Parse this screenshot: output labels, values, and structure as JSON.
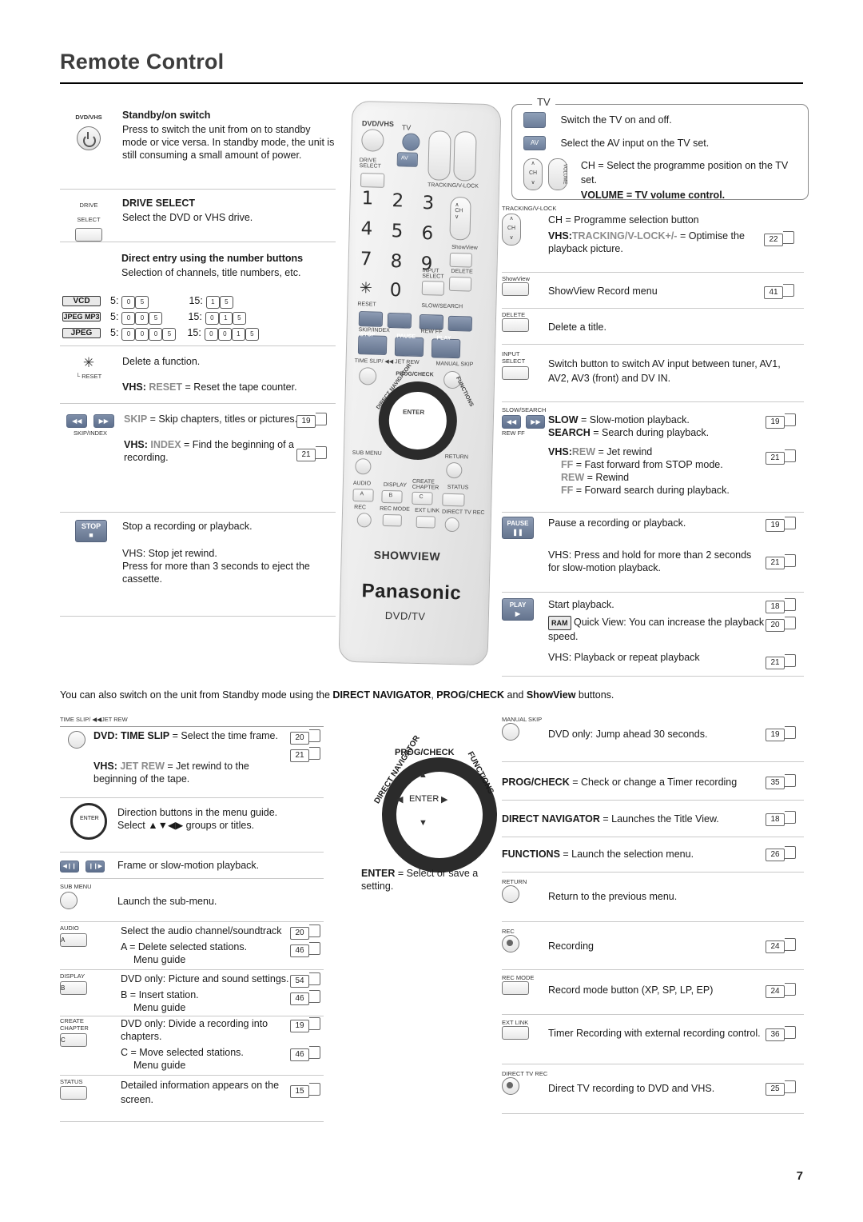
{
  "page": {
    "title": "Remote Control",
    "number": "7",
    "middle_note_parts": {
      "p1": "You can also switch on the unit from Standby mode using the ",
      "b1": "DIRECT NAVIGATOR",
      "p2": ", ",
      "b2": "PROG/CHECK",
      "p3": " and ",
      "b3": "ShowView",
      "p4": " buttons."
    }
  },
  "remote": {
    "brand": "Panasonic",
    "showview": "SHOWVIEW",
    "model": "DVD/TV",
    "dvd_vhs": "DVD/VHS",
    "tv": "TV",
    "labels": {
      "drive_select": "DRIVE\nSELECT",
      "av": "AV",
      "ch": "CH",
      "volume": "VOLUME",
      "tracking": "TRACKING/V-LOCK",
      "showview": "ShowView",
      "input_select": "INPUT\nSELECT",
      "delete": "DELETE",
      "reset": "RESET",
      "skip_index": "SKIP/INDEX",
      "slow_search": "SLOW/SEARCH",
      "rew": "REW",
      "ff": "FF",
      "stop": "STOP",
      "pause": "PAUSE",
      "play": "PLAY",
      "time_slip": "TIME SLIP/",
      "jet_rew": "JET REW",
      "manual_skip": "MANUAL SKIP",
      "direct_navigator": "DIRECT NAVIGATOR",
      "prog_check": "PROG/CHECK",
      "functions": "FUNCTIONS",
      "enter": "ENTER",
      "sub_menu": "SUB MENU",
      "return": "RETURN",
      "audio": "AUDIO",
      "display": "DISPLAY",
      "create_chapter": "CREATE\nCHAPTER",
      "status": "STATUS",
      "a": "A",
      "b": "B",
      "c": "C",
      "rec": "REC",
      "rec_mode": "REC MODE",
      "ext_link": "EXT LINK",
      "direct_tv_rec": "DIRECT TV REC"
    },
    "numbers": [
      "1",
      "2",
      "3",
      "4",
      "5",
      "6",
      "7",
      "8",
      "9",
      "0"
    ],
    "star": "✳"
  },
  "left_column": [
    {
      "id": "standby",
      "icon_label": "DVD/VHS",
      "heading": "Standby/on switch",
      "body": "Press to switch the unit from on to standby mode or vice versa. In standby mode, the unit is still consuming a small amount of power."
    },
    {
      "id": "drive-select",
      "icon_label": "DRIVE\nSELECT",
      "heading": "DRIVE SELECT",
      "body": "Select the DVD or VHS drive."
    },
    {
      "id": "number-buttons",
      "heading": "Direct entry using the number buttons",
      "body": "Selection of channels, title numbers, etc.",
      "examples": [
        {
          "tag": "VCD",
          "left_label": "5:",
          "left_digits": [
            "0",
            "5"
          ],
          "right_label": "15:",
          "right_digits": [
            "1",
            "5"
          ]
        },
        {
          "tag": "JPEG MP3",
          "left_label": "5:",
          "left_digits": [
            "0",
            "0",
            "5"
          ],
          "right_label": "15:",
          "right_digits": [
            "0",
            "1",
            "5"
          ]
        },
        {
          "tag": "JPEG",
          "left_label": "5:",
          "left_digits": [
            "0",
            "0",
            "0",
            "5"
          ],
          "right_label": "15:",
          "right_digits": [
            "0",
            "0",
            "1",
            "5"
          ]
        }
      ]
    },
    {
      "id": "delete-function",
      "icon_label": "RESET",
      "body": "Delete a function.",
      "vhs_line": {
        "prefix": "VHS:",
        "key": "RESET",
        "rest": " = Reset the tape counter."
      }
    },
    {
      "id": "skip",
      "icon_label": "SKIP/INDEX",
      "line1": {
        "key": "SKIP",
        "rest": " = Skip chapters, titles or pictures.",
        "page": "19"
      },
      "line2": {
        "prefix": "VHS:",
        "key": "INDEX",
        "rest": " = Find the beginning of a recording.",
        "page": "21"
      }
    },
    {
      "id": "stop",
      "icon_label": "STOP",
      "body": "Stop a recording or playback.",
      "vhs_body": "VHS: Stop jet rewind.\nPress for more than 3 seconds to eject the cassette."
    }
  ],
  "right_column": {
    "tv_box": {
      "title": "TV",
      "rows": [
        {
          "icon": "power-icon",
          "text": "Switch the TV on and off."
        },
        {
          "icon": "av-button",
          "text": "Select the AV input on the TV set."
        },
        {
          "icon": "ch-volume",
          "text": "CH = Select the programme position on the TV set.",
          "text2": "VOLUME = TV volume control."
        }
      ]
    },
    "rows": [
      {
        "id": "tracking",
        "icon_label": "TRACKING/V-LOCK",
        "line1": "CH = Programme selection button",
        "line2_prefix": "VHS:",
        "line2_key": "TRACKING/V-LOCK+/-",
        "line2_rest": " = Optimise the playback picture.",
        "page": "22"
      },
      {
        "id": "showview",
        "icon_label": "ShowView",
        "text": "ShowView Record menu",
        "page": "41"
      },
      {
        "id": "delete",
        "icon_label": "DELETE",
        "text": "Delete a title.",
        "page": ""
      },
      {
        "id": "input-select",
        "icon_label": "INPUT\nSELECT",
        "text": "Switch button to switch AV input between tuner, AV1, AV2, AV3 (front) and DV IN.",
        "page": ""
      },
      {
        "id": "slow-search",
        "icon_label": "SLOW/SEARCH",
        "sub_labels": "REW     FF",
        "lines": [
          {
            "key": "SLOW",
            "rest": " = Slow-motion playback.",
            "page": "19"
          },
          {
            "key": "SEARCH",
            "rest": " = Search during playback.",
            "page": ""
          },
          {
            "prefix": "VHS:",
            "key": "REW",
            "rest": " = Jet rewind",
            "page": "21"
          },
          {
            "key": "FF",
            "rest": " = Fast forward from STOP mode.",
            "page": ""
          },
          {
            "key": "REW",
            "rest": " = Rewind",
            "page": ""
          },
          {
            "key": "FF",
            "rest": " = Forward search during playback.",
            "page": ""
          }
        ]
      },
      {
        "id": "pause",
        "icon_label": "PAUSE",
        "text": "Pause a recording or playback.",
        "page": "19",
        "vhs_text": "VHS: Press and hold for more than 2 seconds for slow-motion playback.",
        "vhs_page": "21"
      },
      {
        "id": "play",
        "icon_label": "PLAY",
        "text": "Start playback.",
        "page": "18",
        "ram_tag": "RAM",
        "ram_text": "Quick View: You can increase the playback speed.",
        "ram_page": "20",
        "vhs_text": "VHS: Playback or repeat playback",
        "vhs_page": "21"
      }
    ]
  },
  "bottom_left": [
    {
      "id": "time-slip",
      "icon_label": "TIME SLIP/",
      "icon_label2": "JET REW",
      "line1_b": "DVD: TIME SLIP",
      "line1": " = Select the time frame.",
      "page1": "20",
      "line2_prefix": "VHS:",
      "line2_key": "JET REW",
      "line2_rest": " = Jet rewind to the beginning of the tape.",
      "page2": "21"
    },
    {
      "id": "direction",
      "text": "Direction buttons in the menu guide.\nSelect ▲▼◀▶ groups or titles.",
      "enter": "ENTER"
    },
    {
      "id": "frame",
      "text": "Frame or slow-motion playback."
    },
    {
      "id": "sub-menu",
      "icon_label": "SUB MENU",
      "text": "Launch the sub-menu."
    },
    {
      "id": "audio",
      "icon_label": "AUDIO",
      "btn": "A",
      "text": "Select the audio channel/soundtrack",
      "page": "20",
      "text2": "A = Delete selected stations.",
      "page2": "46",
      "menu": "Menu guide"
    },
    {
      "id": "display",
      "icon_label": "DISPLAY",
      "btn": "B",
      "text": "DVD only: Picture and sound settings.",
      "page": "54",
      "text2": "B = Insert station.",
      "page2": "46",
      "menu": "Menu guide"
    },
    {
      "id": "create-chapter",
      "icon_label": "CREATE\nCHAPTER",
      "btn": "C",
      "text": "DVD only: Divide a recording into chapters.",
      "page": "19",
      "text2": "C = Move selected stations.",
      "page2": "46",
      "menu": "Menu guide"
    },
    {
      "id": "status",
      "icon_label": "STATUS",
      "text": "Detailed information appears on the screen.",
      "page": "15"
    }
  ],
  "bottom_middle": {
    "labels": {
      "prog_check": "PROG/CHECK",
      "direct_navigator": "DIRECT NAVIGATOR",
      "functions": "FUNCTIONS",
      "enter": "ENTER"
    },
    "caption_b": "ENTER",
    "caption": " = Select or save a setting."
  },
  "bottom_right": [
    {
      "id": "manual-skip",
      "icon_label": "MANUAL SKIP",
      "text": "DVD only: Jump ahead 30 seconds.",
      "page": "19"
    },
    {
      "id": "prog-check",
      "text_b": "PROG/CHECK",
      "text": " = Check or change a Timer recording",
      "page": "35"
    },
    {
      "id": "direct-navigator",
      "text_b": "DIRECT NAVIGATOR",
      "text": " = Launches the Title View.",
      "page": "18"
    },
    {
      "id": "functions",
      "text_b": "FUNCTIONS",
      "text": " = Launch the selection menu.",
      "page": "26"
    },
    {
      "id": "return",
      "icon_label": "RETURN",
      "text": "Return to the previous menu.",
      "page": ""
    },
    {
      "id": "rec",
      "icon_label": "REC",
      "text": "Recording",
      "page": "24"
    },
    {
      "id": "rec-mode",
      "icon_label": "REC MODE",
      "text": "Record mode button (XP, SP, LP, EP)",
      "page": "24"
    },
    {
      "id": "ext-link",
      "icon_label": "EXT LINK",
      "text": "Timer Recording with external recording control.",
      "page": "36"
    },
    {
      "id": "direct-tv-rec",
      "icon_label": "DIRECT TV REC",
      "text": "Direct TV recording to DVD and VHS.",
      "page": "25"
    }
  ]
}
